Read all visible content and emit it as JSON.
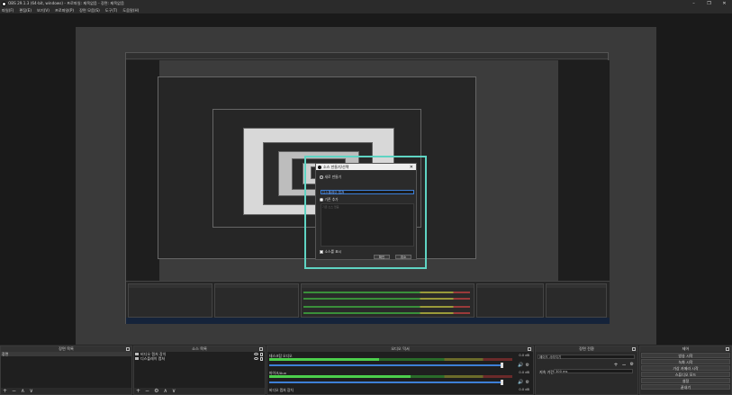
{
  "window": {
    "title": "OBS 29.1.3 (64-bit, windows) - 프로파일: 제목없음 - 장면: 제목없음",
    "controls": [
      "–",
      "❐",
      "✕"
    ]
  },
  "menu": [
    "파일(F)",
    "편집(E)",
    "보기(V)",
    "프로파일(P)",
    "장면 모음(S)",
    "도구(T)",
    "도움말(H)"
  ],
  "dialog": {
    "title": "소스 만들기/선택",
    "create_new": "새로 만들기",
    "input_value": "디스플레이 캡쳐",
    "add_existing": "기존 추가",
    "list_hint": "기존 소스 없음",
    "make_visible": "소스를 표시",
    "ok": "확인",
    "cancel": "취소"
  },
  "docks": {
    "scenes": {
      "title": "장면 목록",
      "items": [
        "장면"
      ],
      "footer": [
        "+",
        "−",
        "∧",
        "∨"
      ]
    },
    "sources": {
      "title": "소스 목록",
      "items": [
        "비디오 캡처 장치",
        "디스플레이 캡쳐"
      ],
      "footer": [
        "+",
        "−",
        "⚙",
        "∧",
        "∨"
      ]
    },
    "mixer": {
      "title": "오디오 믹서",
      "channels": [
        {
          "name": "데스크탑 오디오",
          "db": "0.0 dB",
          "level": 0.45
        },
        {
          "name": "마이크/Aux",
          "db": "0.0 dB",
          "level": 0.58
        },
        {
          "name": "비디오 캡처 장치",
          "db": "0.0 dB",
          "level": 0.0
        }
      ]
    },
    "transitions": {
      "title": "장면 전환",
      "type": "페이드 사라지기",
      "duration_label": "지속 기간",
      "duration_value": "300 ms"
    },
    "controls": {
      "title": "제어",
      "buttons": [
        "방송 시작",
        "녹화 시작",
        "가상 카메라 시작",
        "스튜디오 모드",
        "설정",
        "끝내기"
      ]
    }
  },
  "colors": {
    "accent": "#5fd4c3",
    "selection": "#3d7fd6",
    "background": "#1e1e1e"
  }
}
